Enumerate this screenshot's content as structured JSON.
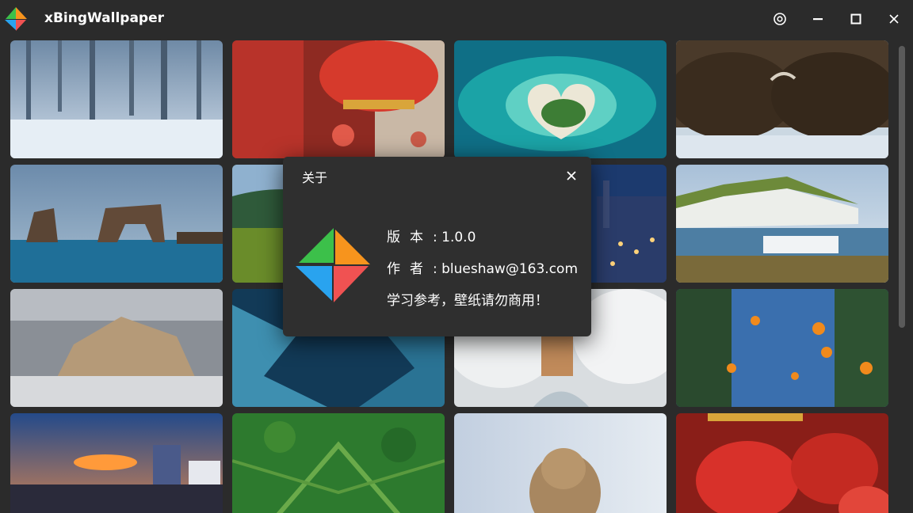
{
  "window": {
    "title": "xBingWallpaper",
    "controls": [
      "settings-icon",
      "minimize-icon",
      "maximize-icon",
      "close-icon"
    ]
  },
  "colors": {
    "background": "#2b2b2b",
    "dialog_background": "#2f2f2f",
    "logo_green": "#3cc04a",
    "logo_orange": "#f7941d",
    "logo_blue": "#29a3ef",
    "logo_red": "#f05252"
  },
  "wallpapers": [
    {
      "subject": "snowy forest"
    },
    {
      "subject": "red lantern"
    },
    {
      "subject": "heart-shaped island"
    },
    {
      "subject": "bison in snow"
    },
    {
      "subject": "rock arch in sea"
    },
    {
      "subject": "green hills"
    },
    {
      "subject": "city at night"
    },
    {
      "subject": "white chalk cliffs"
    },
    {
      "subject": "hilltop village in snow"
    },
    {
      "subject": "frost patterns"
    },
    {
      "subject": "snowy trees"
    },
    {
      "subject": "monarch butterflies"
    },
    {
      "subject": "stadium city night"
    },
    {
      "subject": "green forest aerial"
    },
    {
      "subject": "marmot"
    },
    {
      "subject": "red lanterns"
    }
  ],
  "about_dialog": {
    "title": "关于",
    "version_label": "版本",
    "version_value": "1.0.0",
    "author_label": "作者",
    "author_value": "blueshaw@163.com",
    "notice": "学习参考，壁纸请勿商用！"
  }
}
